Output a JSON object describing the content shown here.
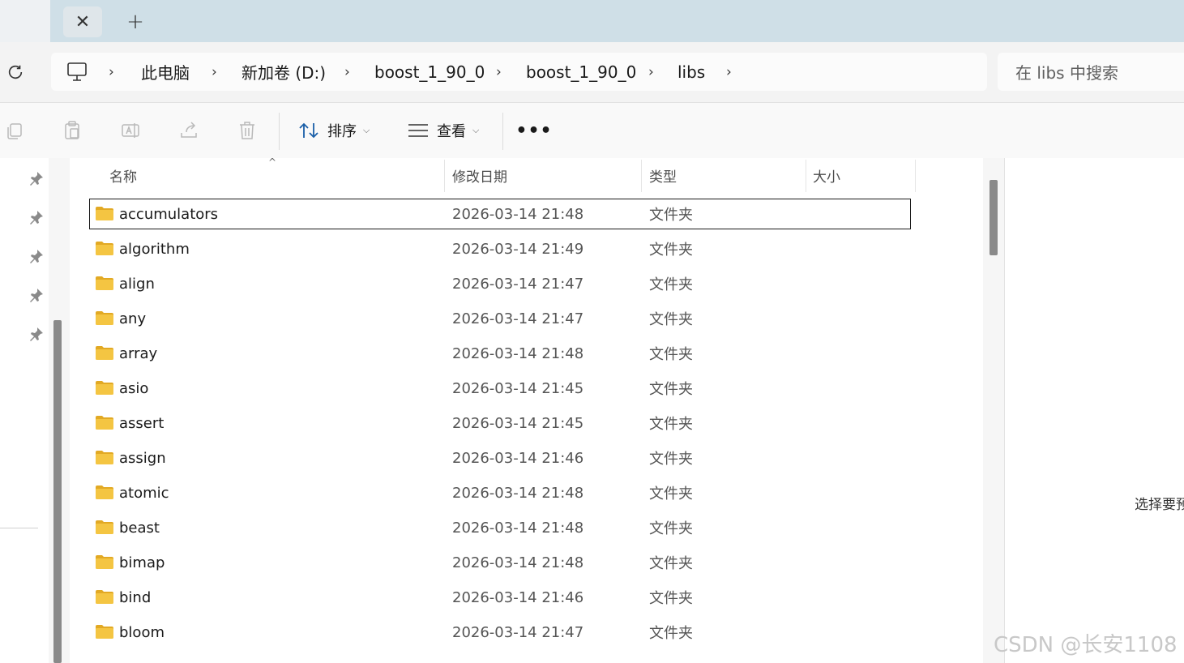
{
  "tabs": {
    "close_glyph": "✕",
    "new_glyph": "+"
  },
  "breadcrumb": [
    {
      "label": "此电脑"
    },
    {
      "label": "新加卷 (D:)"
    },
    {
      "label": "boost_1_90_0"
    },
    {
      "label": "boost_1_90_0"
    },
    {
      "label": "libs"
    }
  ],
  "search": {
    "placeholder": "在 libs 中搜索"
  },
  "toolbar": {
    "sort_label": "排序",
    "view_label": "查看",
    "more_label": "•••"
  },
  "columns": {
    "name": "名称",
    "modified": "修改日期",
    "type": "类型",
    "size": "大小"
  },
  "files": [
    {
      "name": "accumulators",
      "modified": "2026-03-14 21:48",
      "type": "文件夹"
    },
    {
      "name": "algorithm",
      "modified": "2026-03-14 21:49",
      "type": "文件夹"
    },
    {
      "name": "align",
      "modified": "2026-03-14 21:47",
      "type": "文件夹"
    },
    {
      "name": "any",
      "modified": "2026-03-14 21:47",
      "type": "文件夹"
    },
    {
      "name": "array",
      "modified": "2026-03-14 21:48",
      "type": "文件夹"
    },
    {
      "name": "asio",
      "modified": "2026-03-14 21:45",
      "type": "文件夹"
    },
    {
      "name": "assert",
      "modified": "2026-03-14 21:45",
      "type": "文件夹"
    },
    {
      "name": "assign",
      "modified": "2026-03-14 21:46",
      "type": "文件夹"
    },
    {
      "name": "atomic",
      "modified": "2026-03-14 21:48",
      "type": "文件夹"
    },
    {
      "name": "beast",
      "modified": "2026-03-14 21:48",
      "type": "文件夹"
    },
    {
      "name": "bimap",
      "modified": "2026-03-14 21:48",
      "type": "文件夹"
    },
    {
      "name": "bind",
      "modified": "2026-03-14 21:46",
      "type": "文件夹"
    },
    {
      "name": "bloom",
      "modified": "2026-03-14 21:47",
      "type": "文件夹"
    }
  ],
  "preview": {
    "text": "选择要预"
  },
  "watermark": "CSDN @长安1108",
  "colors": {
    "folder": "#f4c542",
    "folder_dark": "#e2a924",
    "tabbar": "#cfdfe7"
  }
}
